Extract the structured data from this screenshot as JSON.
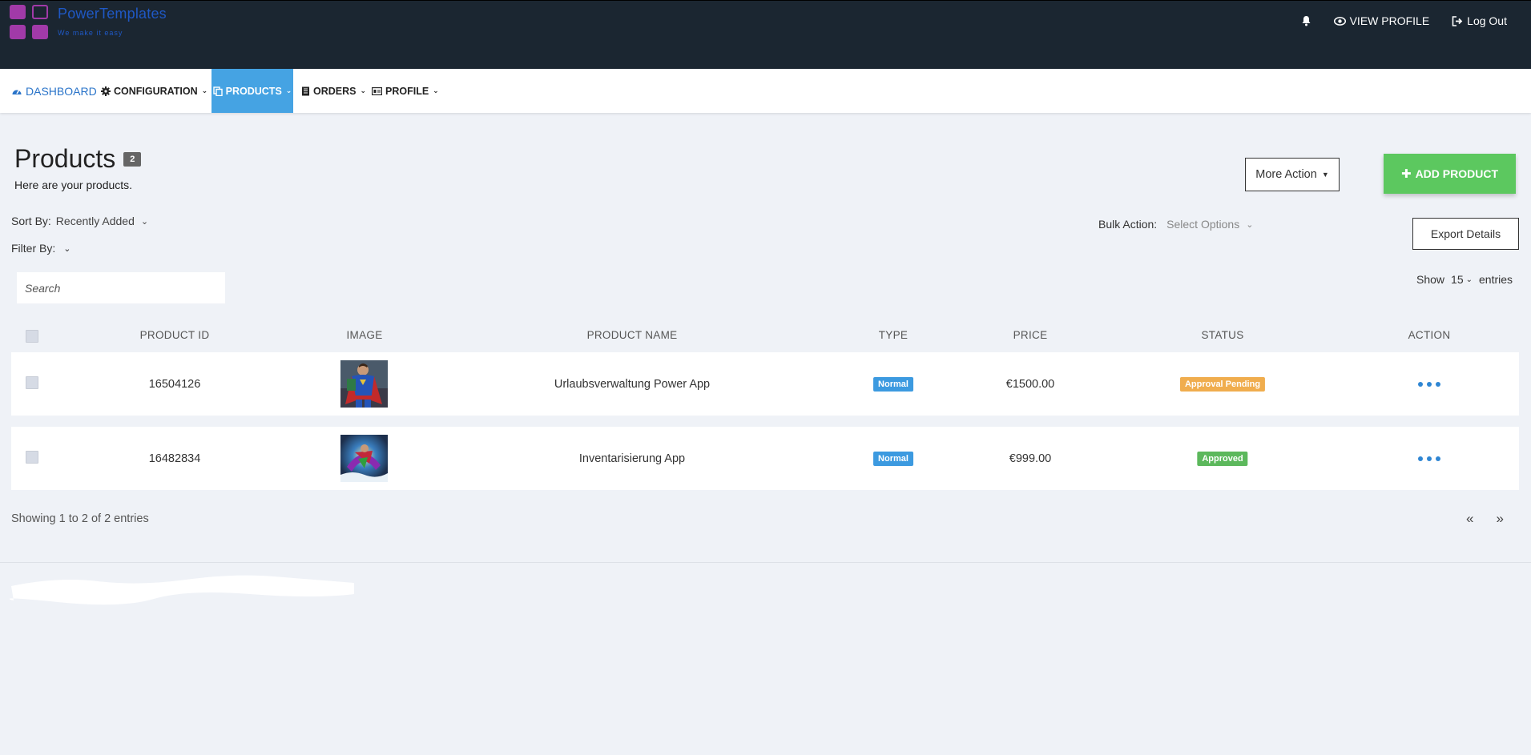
{
  "brand": {
    "name": "PowerTemplates",
    "tagline": "We make it easy"
  },
  "header": {
    "view_profile": "VIEW PROFILE",
    "logout": "Log Out"
  },
  "nav": {
    "dashboard": "DASHBOARD",
    "configuration": "CONFIGURATION",
    "products": "PRODUCTS",
    "orders": "ORDERS",
    "profile": "PROFILE",
    "active": "products"
  },
  "page": {
    "title": "Products",
    "count": "2",
    "subtitle": "Here are your products."
  },
  "actions": {
    "more_action": "More Action",
    "add_product": "ADD PRODUCT",
    "export": "Export Details"
  },
  "controls": {
    "sort_label": "Sort By:",
    "sort_value": "Recently Added",
    "filter_label": "Filter By:",
    "bulk_label": "Bulk Action:",
    "bulk_value": "Select Options",
    "search_placeholder": "Search",
    "show_label": "Show",
    "show_value": "15",
    "entries_label": "entries"
  },
  "table": {
    "columns": [
      "PRODUCT ID",
      "IMAGE",
      "PRODUCT NAME",
      "TYPE",
      "PRICE",
      "STATUS",
      "ACTION"
    ],
    "rows": [
      {
        "id": "16504126",
        "name": "Urlaubsverwaltung Power App",
        "type": "Normal",
        "price": "€1500.00",
        "status": "Approval Pending",
        "status_color": "#f0ad4e"
      },
      {
        "id": "16482834",
        "name": "Inventarisierung App",
        "type": "Normal",
        "price": "€999.00",
        "status": "Approved",
        "status_color": "#5cb85c"
      }
    ]
  },
  "footer": {
    "showing": "Showing 1 to 2 of 2 entries",
    "prev": "«",
    "next": "»"
  },
  "colors": {
    "header_bg": "#1b2631",
    "nav_active": "#45a3e3",
    "add_button": "#5cc85f",
    "type_badge": "#3c9ae0",
    "link": "#2a74c9"
  }
}
